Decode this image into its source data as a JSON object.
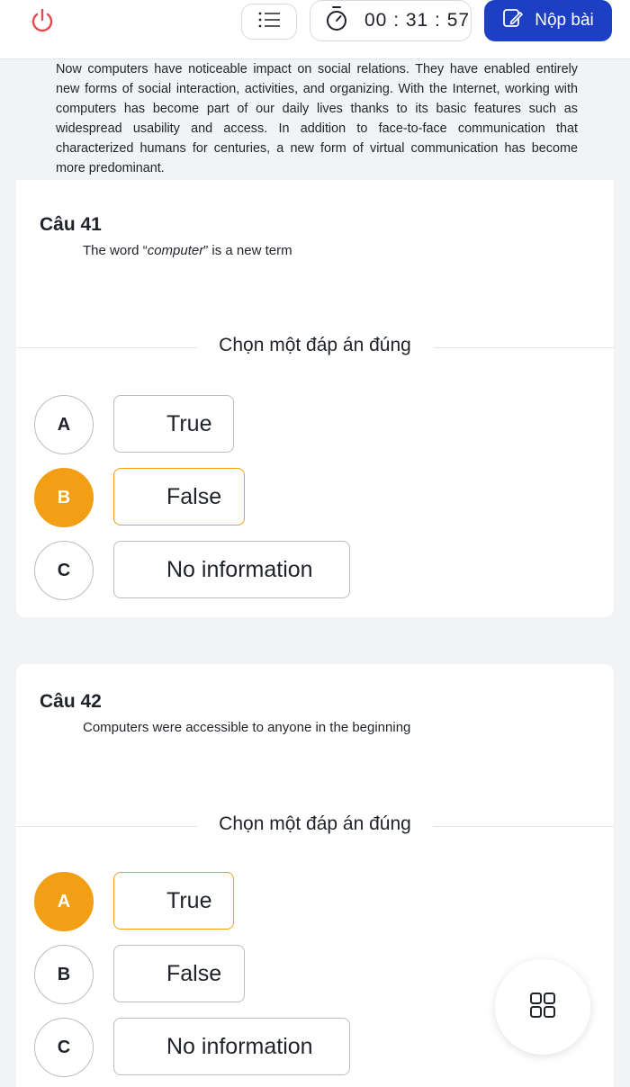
{
  "header": {
    "timer": "00 : 31 : 57",
    "submit_label": "Nộp bài",
    "icons": [
      "power-icon",
      "list-menu-icon",
      "stopwatch-icon",
      "edit-note-icon"
    ]
  },
  "passage": "Now computers have noticeable impact on social relations. They have enabled entirely new forms of social interaction, activities, and organizing. With the Internet, working with computers has become part of our daily lives thanks to its basic features such as widespread usability and access. In addition to face-to-face communication that characterized humans for centuries, a new form of virtual communication has become more predominant.",
  "questions": [
    {
      "number": "Câu 41",
      "text_before": "The word “",
      "text_italic": "computer",
      "text_after": "” is a new term",
      "instruction": "Chọn một đáp án đúng",
      "selected": "B",
      "options": [
        {
          "letter": "A",
          "label": "True"
        },
        {
          "letter": "B",
          "label": "False"
        },
        {
          "letter": "C",
          "label": "No information"
        }
      ]
    },
    {
      "number": "Câu 42",
      "text": "Computers were accessible to anyone in the beginning",
      "instruction": "Chọn một đáp án đúng",
      "selected": "A",
      "options": [
        {
          "letter": "A",
          "label": "True"
        },
        {
          "letter": "B",
          "label": "False"
        },
        {
          "letter": "C",
          "label": "No information"
        }
      ]
    }
  ],
  "colors": {
    "primary": "#1d3fc4",
    "selected": "#f29f16",
    "background": "#f2f3f5"
  }
}
